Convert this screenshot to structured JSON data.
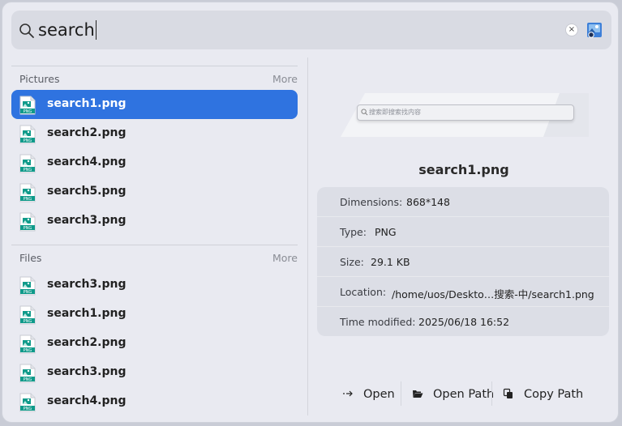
{
  "search": {
    "query": "search",
    "clear_label": "×"
  },
  "sections": {
    "pictures": {
      "title": "Pictures",
      "more": "More",
      "items": [
        {
          "label": "search1.png"
        },
        {
          "label": "search2.png"
        },
        {
          "label": "search4.png"
        },
        {
          "label": "search5.png"
        },
        {
          "label": "search3.png"
        }
      ]
    },
    "files": {
      "title": "Files",
      "more": "More",
      "items": [
        {
          "label": "search3.png"
        },
        {
          "label": "search1.png"
        },
        {
          "label": "search2.png"
        },
        {
          "label": "search3.png"
        },
        {
          "label": "search4.png"
        }
      ]
    }
  },
  "preview": {
    "thumbnail_text": "搜索即搜索找内容",
    "filename": "search1.png",
    "details": [
      {
        "key": "Dimensions:",
        "value": "868*148"
      },
      {
        "key": "Type:",
        "value": "PNG"
      },
      {
        "key": "Size:",
        "value": "29.1 KB"
      },
      {
        "key": "Location:",
        "value": "/home/uos/Deskto…搜索-中/search1.png"
      },
      {
        "key": "Time modified:",
        "value": "2025/06/18 16:52"
      }
    ]
  },
  "actions": {
    "open": "Open",
    "open_path": "Open Path",
    "copy_path": "Copy Path"
  },
  "file_icon_badge": "PNG",
  "colors": {
    "accent": "#2f73e0",
    "icon_teal": "#0f9a8a"
  }
}
